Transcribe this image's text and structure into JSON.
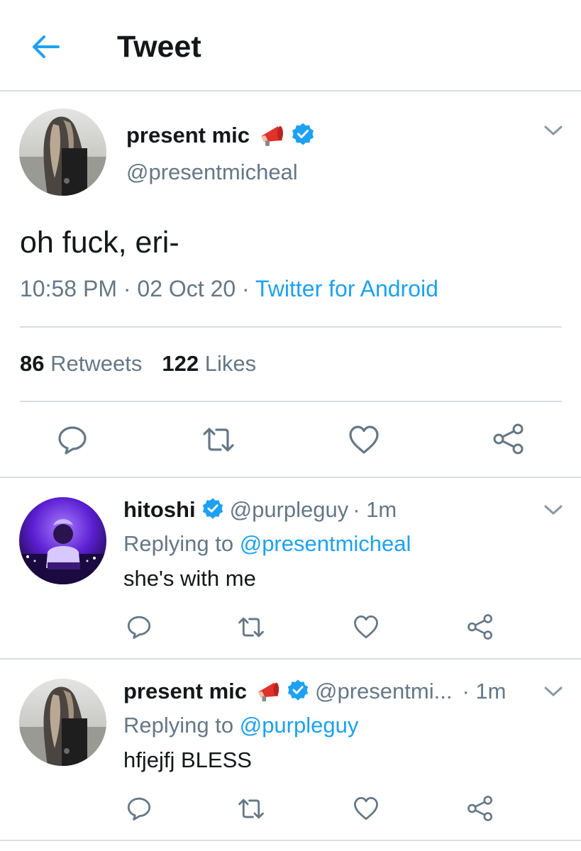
{
  "header": {
    "title": "Tweet"
  },
  "main_tweet": {
    "author_name": "present mic",
    "author_emoji": "megaphone",
    "verified": true,
    "handle": "@presentmicheal",
    "text": "oh fuck, eri-",
    "time": "10:58 PM",
    "date": "02 Oct 20",
    "source": "Twitter for Android",
    "separator": " · ",
    "retweets_count": "86",
    "retweets_label": "Retweets",
    "likes_count": "122",
    "likes_label": "Likes"
  },
  "replies": [
    {
      "author_name": "hitoshi",
      "verified": true,
      "handle": "@purpleguy",
      "time": "· 1m",
      "replying_label": "Replying to",
      "replying_to": "@presentmicheal",
      "text": "she's with me"
    },
    {
      "author_name": "present mic",
      "author_emoji": "megaphone",
      "verified": true,
      "handle": "@presentmi...",
      "time": "· 1m",
      "replying_label": "Replying to",
      "replying_to": "@purpleguy",
      "text": "hfjejfj BLESS"
    }
  ],
  "colors": {
    "accent": "#1da1f2",
    "secondary_text": "#657786",
    "primary_text": "#14171a",
    "divider": "#d9dee2"
  },
  "icons": [
    "back-arrow-icon",
    "verified-badge-icon",
    "megaphone-icon",
    "chevron-down-icon",
    "reply-icon",
    "retweet-icon",
    "like-icon",
    "share-icon"
  ]
}
